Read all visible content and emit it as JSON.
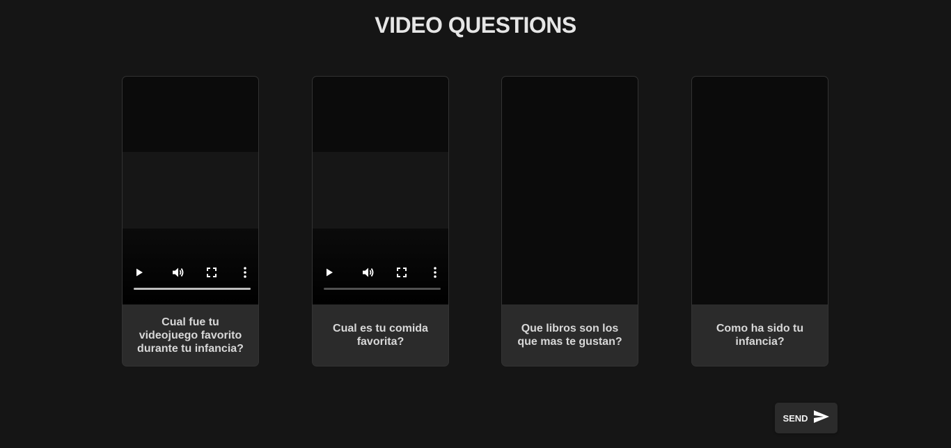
{
  "header": {
    "title": "VIDEO QUESTIONS"
  },
  "cards": [
    {
      "question": "Cual fue tu videojuego favorito durante tu infancia?",
      "has_player": true,
      "progress": 1.0
    },
    {
      "question": "Cual es tu comida favorita?",
      "has_player": true,
      "progress": 0.0
    },
    {
      "question": "Que libros son los que mas te gustan?",
      "has_player": false
    },
    {
      "question": "Como ha sido tu infancia?",
      "has_player": false
    }
  ],
  "player_icons": [
    "play-icon",
    "volume-icon",
    "fullscreen-icon",
    "more-options-icon"
  ],
  "actions": {
    "send_label": "SEND",
    "send_icon": "send-icon"
  },
  "colors": {
    "background": "#151515",
    "card": "#2b2b2b",
    "video": "#0b0b0b",
    "text": "#e4e4e4"
  }
}
